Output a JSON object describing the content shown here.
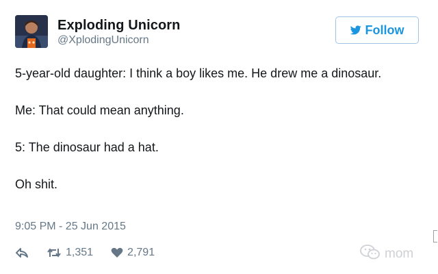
{
  "author": {
    "display_name": "Exploding Unicorn",
    "handle": "@XplodingUnicorn"
  },
  "follow_button": {
    "label": "Follow",
    "icon": "twitter-bird-icon"
  },
  "tweet": {
    "lines": [
      "5-year-old daughter: I think a boy likes me. He drew me a dinosaur.",
      "Me: That could mean anything.",
      "5: The dinosaur had a hat.",
      "Oh shit."
    ],
    "timestamp": "9:05 PM - 25 Jun 2015"
  },
  "actions": {
    "reply_icon": "reply-icon",
    "retweet_icon": "retweet-icon",
    "retweet_count": "1,351",
    "like_icon": "heart-icon",
    "like_count": "2,791"
  },
  "watermark": {
    "icon": "wechat-icon",
    "text": "mom"
  },
  "colors": {
    "accent": "#1b95e0",
    "secondary_text": "#657786",
    "primary_text": "#14171a"
  }
}
